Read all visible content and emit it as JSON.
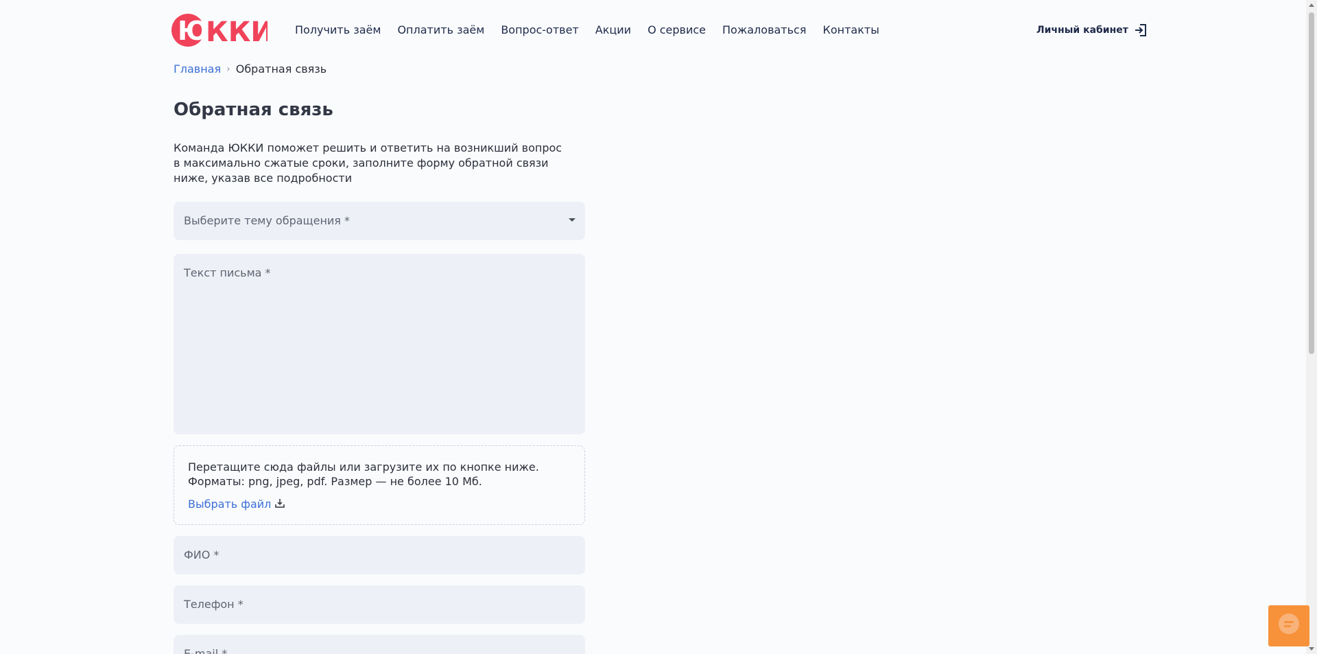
{
  "logo": {
    "text": "ЮККИ",
    "color": "#f0435a"
  },
  "nav": {
    "items": [
      {
        "label": "Получить заём"
      },
      {
        "label": "Оплатить заём"
      },
      {
        "label": "Вопрос-ответ"
      },
      {
        "label": "Акции"
      },
      {
        "label": "О сервисе"
      },
      {
        "label": "Пожаловаться"
      },
      {
        "label": "Контакты"
      }
    ],
    "cabinet_label": "Личный кабинет",
    "cabinet_icon": "login-icon"
  },
  "breadcrumb": {
    "home": "Главная",
    "current": "Обратная связь"
  },
  "page": {
    "title": "Обратная связь",
    "intro": "Команда ЮККИ поможет решить и ответить на возникший вопрос в максимально сжатые сроки, заполните форму обратной связи ниже, указав все подробности"
  },
  "form": {
    "topic_placeholder": "Выберите тему обращения *",
    "message_placeholder": "Текст письма *",
    "dropzone_line1": "Перетащите сюда файлы или загрузите их по кнопке ниже.",
    "dropzone_line2": "Форматы: png, jpeg, pdf. Размер — не более 10 Мб.",
    "choose_file_label": "Выбрать файл",
    "fio_placeholder": "ФИО *",
    "phone_placeholder": "Телефон *",
    "email_placeholder": "E-mail *"
  },
  "colors": {
    "accent": "#f0435a",
    "link": "#3b6fd6",
    "chat": "#f7923a",
    "field_bg": "#eef0f7"
  },
  "chat_widget": {
    "icon": "chat-icon"
  }
}
